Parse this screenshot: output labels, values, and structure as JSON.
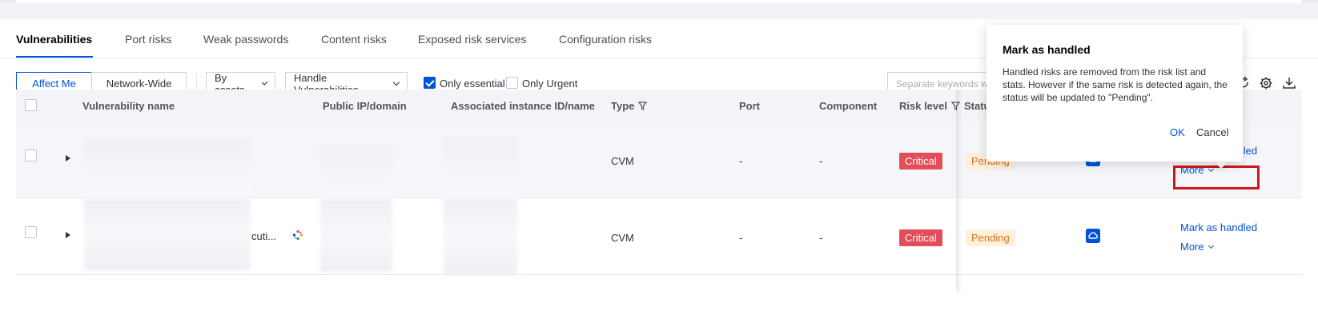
{
  "tabs": [
    {
      "label": "Vulnerabilities",
      "active": true
    },
    {
      "label": "Port risks"
    },
    {
      "label": "Weak passwords"
    },
    {
      "label": "Content risks"
    },
    {
      "label": "Exposed risk services"
    },
    {
      "label": "Configuration risks"
    }
  ],
  "toolbar": {
    "scope": {
      "affect_me": "Affect Me",
      "network_wide": "Network-Wide"
    },
    "by_assets": "By assets",
    "handle": "Handle Vulnerabilities",
    "only_essential": "Only essential",
    "only_urgent": "Only Urgent",
    "search_placeholder": "Separate keywords w"
  },
  "table": {
    "headers": {
      "name": "Vulnerability name",
      "ip": "Public IP/domain",
      "instance": "Associated instance ID/name",
      "type": "Type",
      "port": "Port",
      "component": "Component",
      "risk": "Risk level",
      "status": "Status"
    },
    "rows": [
      {
        "name_suffix": "",
        "type": "CVM",
        "port": "-",
        "component": "-",
        "risk": "Critical",
        "status": "Pending",
        "action": "Mark as handled",
        "more": "More"
      },
      {
        "name_suffix": "cuti...",
        "type": "CVM",
        "port": "-",
        "component": "-",
        "risk": "Critical",
        "status": "Pending",
        "action": "Mark as handled",
        "more": "More"
      }
    ]
  },
  "popover": {
    "title": "Mark as handled",
    "body": "Handled risks are removed from the risk list and stats. However if the same risk is detected again, the status will be updated to \"Pending\".",
    "ok": "OK",
    "cancel": "Cancel"
  },
  "colors": {
    "accent": "#0052d9",
    "critical": "#e34d59",
    "pending_bg": "#fdf1dd",
    "pending_text": "#e37318",
    "highlight": "#d0161b"
  },
  "icons": [
    "filter-icon",
    "refresh-icon",
    "gear-icon",
    "download-icon",
    "cloud-icon",
    "expand-icon"
  ]
}
